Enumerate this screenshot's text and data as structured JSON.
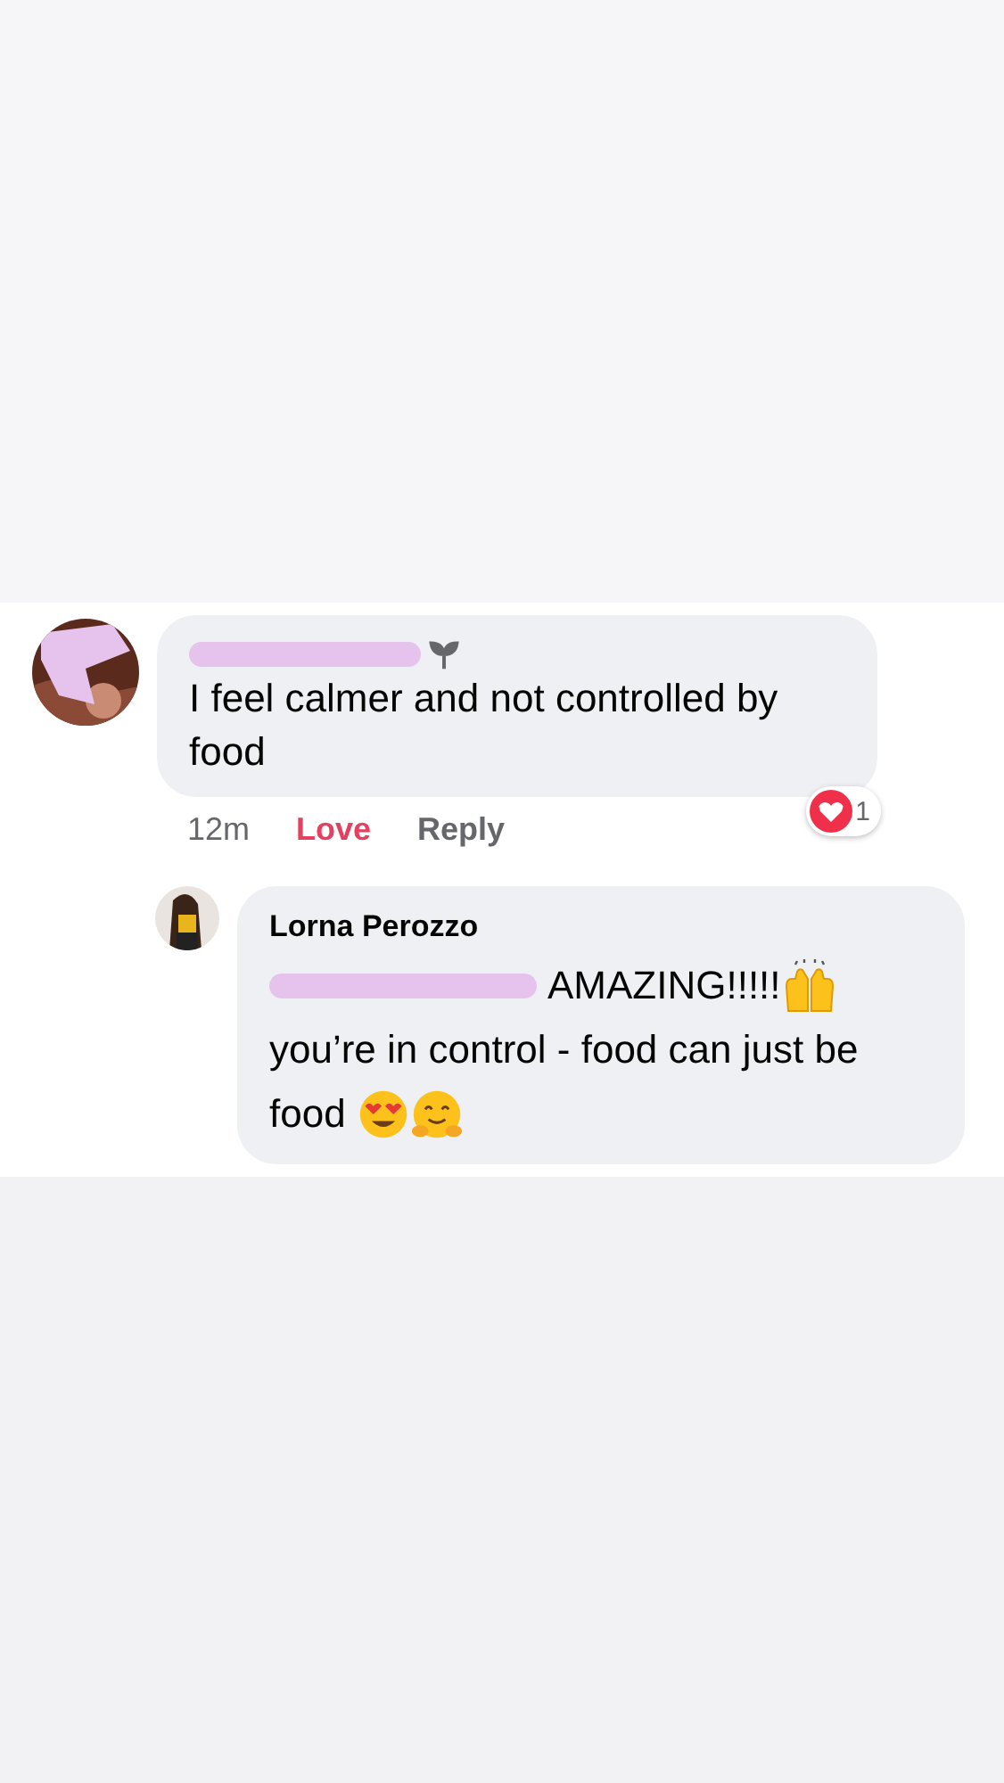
{
  "comment": {
    "lines": [
      "I feel calmer and not controlled by",
      "food"
    ],
    "time": "12m",
    "reaction_label": "Love",
    "loved": true,
    "reply_label": "Reply",
    "reaction_count": "1"
  },
  "reply": {
    "author": "Lorna Perozzo",
    "lines": [
      [
        {
          "kind": "mention"
        },
        {
          "kind": "text",
          "text": "AMAZING!!!!!"
        },
        {
          "kind": "hands"
        }
      ],
      [
        {
          "kind": "text",
          "text": "you’re in control - food can just be"
        }
      ],
      [
        {
          "kind": "text",
          "text": "food "
        },
        {
          "kind": "hearteyes"
        },
        {
          "kind": "hug"
        }
      ]
    ]
  }
}
